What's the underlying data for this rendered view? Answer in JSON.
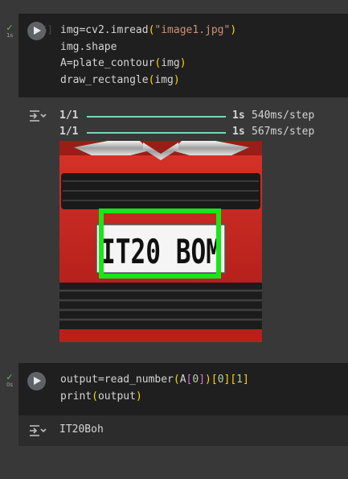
{
  "cells": [
    {
      "status_time": "1s",
      "exec_count": "[25]",
      "code_lines": [
        [
          {
            "t": "img=cv2.imread",
            "c": "t-pl"
          },
          {
            "t": "(",
            "c": "t-par"
          },
          {
            "t": "\"image1.jpg\"",
            "c": "t-str"
          },
          {
            "t": ")",
            "c": "t-par"
          }
        ],
        [
          {
            "t": "img.shape",
            "c": "t-pl"
          }
        ],
        [
          {
            "t": "A=plate_contour",
            "c": "t-pl"
          },
          {
            "t": "(",
            "c": "t-par"
          },
          {
            "t": "img",
            "c": "t-pl"
          },
          {
            "t": ")",
            "c": "t-par"
          }
        ],
        [
          {
            "t": "draw_rectangle",
            "c": "t-pl"
          },
          {
            "t": "(",
            "c": "t-par"
          },
          {
            "t": "img",
            "c": "t-pl"
          },
          {
            "t": ")",
            "c": "t-par"
          }
        ]
      ],
      "output": {
        "progress": [
          {
            "count": "1/1",
            "duration": "1s",
            "step": "540ms/step",
            "fraction": 1.0
          },
          {
            "count": "1/1",
            "duration": "1s",
            "step": "567ms/step",
            "fraction": 1.0
          }
        ],
        "image": {
          "plate_text": "IT20 BOM"
        }
      }
    },
    {
      "status_time": "0s",
      "code_lines": [
        [
          {
            "t": "output=read_number",
            "c": "t-pl"
          },
          {
            "t": "(",
            "c": "t-par"
          },
          {
            "t": "A",
            "c": "t-pl"
          },
          {
            "t": "[",
            "c": "t-par2"
          },
          {
            "t": "0",
            "c": "t-num"
          },
          {
            "t": "]",
            "c": "t-par2"
          },
          {
            "t": ")",
            "c": "t-par"
          },
          {
            "t": "[",
            "c": "t-par"
          },
          {
            "t": "0",
            "c": "t-num"
          },
          {
            "t": "]",
            "c": "t-par"
          },
          {
            "t": "[",
            "c": "t-par"
          },
          {
            "t": "1",
            "c": "t-num"
          },
          {
            "t": "]",
            "c": "t-par"
          }
        ],
        [
          {
            "t": "print",
            "c": "t-pl"
          },
          {
            "t": "(",
            "c": "t-par"
          },
          {
            "t": "output",
            "c": "t-pl"
          },
          {
            "t": ")",
            "c": "t-par"
          }
        ]
      ],
      "output": {
        "text": "IT20Boh"
      }
    }
  ],
  "colors": {
    "page_bg": "#383838",
    "cell_bg": "#1f1f1f",
    "success_tick": "#66bb6a",
    "progress_bar": "#7fd4b8",
    "bbox_green": "#19e619"
  },
  "icons": {
    "status": "check-icon",
    "run": "play-icon",
    "output_toggle": "output-collapse-icon"
  }
}
